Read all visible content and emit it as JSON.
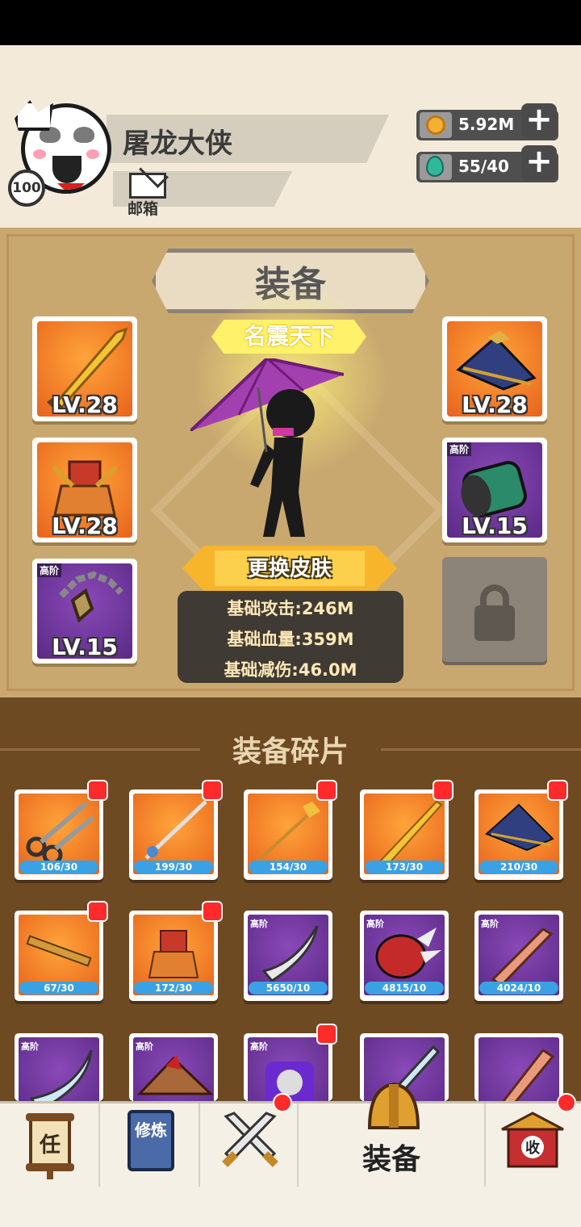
{
  "player": {
    "name": "屠龙大侠",
    "level": "100",
    "mail_label": "邮箱"
  },
  "resources": {
    "coins": "5.92M",
    "gems": "55/40",
    "add_symbol": "+"
  },
  "equipment": {
    "title": "装备",
    "character_title": "名震天下",
    "change_skin_label": "更换皮肤",
    "stats": [
      "基础攻击:246M",
      "基础血量:359M",
      "基础减伤:46.0M"
    ],
    "slots": [
      {
        "item": "golden-sword",
        "level": "LV.28",
        "tier": "",
        "color": "orange"
      },
      {
        "item": "hat",
        "level": "LV.28",
        "tier": "",
        "color": "orange"
      },
      {
        "item": "armor",
        "level": "LV.28",
        "tier": "",
        "color": "orange"
      },
      {
        "item": "gauntlet",
        "level": "LV.15",
        "tier": "高阶",
        "color": "purple"
      },
      {
        "item": "necklace",
        "level": "LV.15",
        "tier": "高阶",
        "color": "purple"
      }
    ]
  },
  "fragments": {
    "title": "装备碎片",
    "items": [
      {
        "item": "scissors",
        "count": "106/30",
        "tier": "",
        "color": "orange",
        "alert": true
      },
      {
        "item": "spear",
        "count": "199/30",
        "tier": "",
        "color": "orange",
        "alert": true
      },
      {
        "item": "trident",
        "count": "154/30",
        "tier": "",
        "color": "orange",
        "alert": true
      },
      {
        "item": "golden-sword",
        "count": "173/30",
        "tier": "",
        "color": "orange",
        "alert": true
      },
      {
        "item": "hat",
        "count": "210/30",
        "tier": "",
        "color": "orange",
        "alert": true
      },
      {
        "item": "key",
        "count": "67/30",
        "tier": "",
        "color": "orange",
        "alert": true
      },
      {
        "item": "armor",
        "count": "172/30",
        "tier": "",
        "color": "orange",
        "alert": true
      },
      {
        "item": "blade",
        "count": "5650/10",
        "tier": "高阶",
        "color": "purple",
        "alert": false
      },
      {
        "item": "spiked-gauntlet",
        "count": "4815/10",
        "tier": "高阶",
        "color": "purple",
        "alert": false
      },
      {
        "item": "wooden-sword",
        "count": "4024/10",
        "tier": "高阶",
        "color": "purple",
        "alert": false
      },
      {
        "item": "curved-blade",
        "count": "",
        "tier": "高阶",
        "color": "purple",
        "alert": false
      },
      {
        "item": "straw-hat",
        "count": "",
        "tier": "高阶",
        "color": "purple",
        "alert": false
      },
      {
        "item": "orb",
        "count": "",
        "tier": "高阶",
        "color": "purple",
        "alert": true
      },
      {
        "item": "ice-sword",
        "count": "",
        "tier": "",
        "color": "purple",
        "alert": false
      },
      {
        "item": "wood-blade",
        "count": "",
        "tier": "",
        "color": "purple",
        "alert": false
      }
    ]
  },
  "nav": {
    "task_icon_text": "任",
    "train_icon_text": "修炼",
    "equip_label": "装备",
    "collect_icon_text": "收"
  },
  "colors": {
    "orange_item": "#f08a2a",
    "purple_item": "#6e3a9e",
    "panel": "#c9a870",
    "fragments_bg": "#6e4a23"
  }
}
